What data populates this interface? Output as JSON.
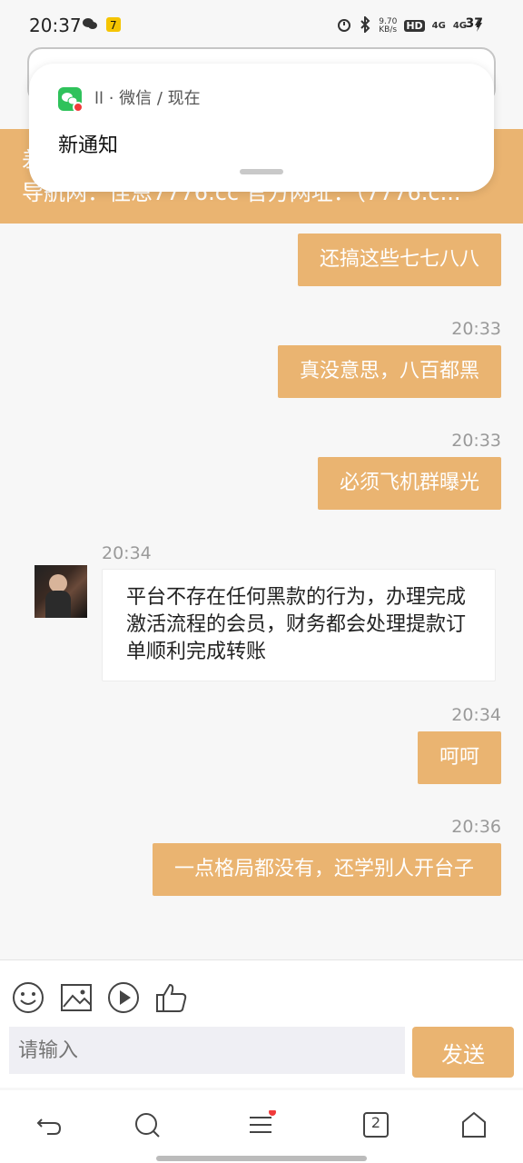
{
  "status_bar": {
    "time": "20:37",
    "net_speed": "9.70",
    "net_unit": "KB/s",
    "hd_label": "HD",
    "sim1": "4G",
    "sim2": "4G",
    "battery": "37"
  },
  "notification": {
    "app_meta": "ll · 微信 / 现在",
    "title": "新通知"
  },
  "banner": {
    "line1": "差",
    "line2": "导航网：佳恩7776.cc 官方网址：（7776.c..."
  },
  "messages": {
    "m1": {
      "text": "还搞这些七七八八"
    },
    "m2": {
      "time": "20:33",
      "text": "真没意思，八百都黑"
    },
    "m3": {
      "time": "20:33",
      "text": "必须飞机群曝光"
    },
    "m4": {
      "time": "20:34",
      "text": "平台不存在任何黑款的行为，办理完成激活流程的会员，财务都会处理提款订单顺利完成转账"
    },
    "m5": {
      "time": "20:34",
      "text": "呵呵"
    },
    "m6": {
      "time": "20:36",
      "text": "一点格局都没有，还学别人开台子"
    }
  },
  "composer": {
    "placeholder": "请输入",
    "send_label": "发送"
  },
  "nav": {
    "tabs_count": "2"
  },
  "colors": {
    "accent": "#eab471"
  }
}
